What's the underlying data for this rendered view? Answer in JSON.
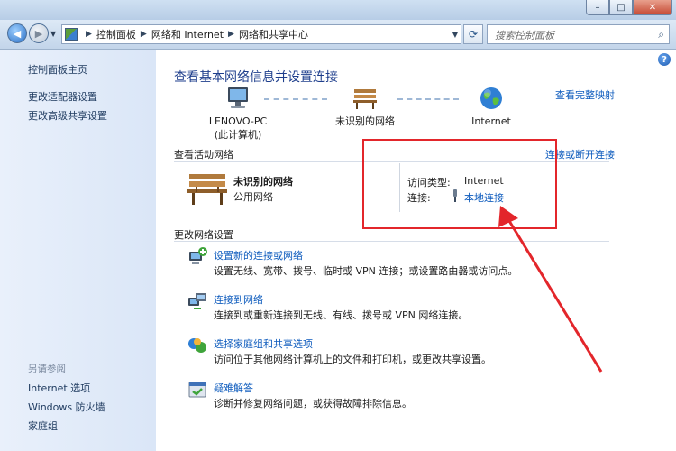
{
  "window": {
    "minimize": "–",
    "maximize": "□",
    "close": "✕"
  },
  "toolbar": {
    "back_glyph": "◀",
    "forward_glyph": "▶",
    "breadcrumb": [
      "控制面板",
      "网络和 Internet",
      "网络和共享中心"
    ],
    "search_placeholder": "搜索控制面板"
  },
  "sidebar": {
    "items": [
      "控制面板主页",
      "更改适配器设置",
      "更改高级共享设置"
    ],
    "see_also_title": "另请参阅",
    "see_also": [
      "Internet 选项",
      "Windows 防火墙",
      "家庭组"
    ]
  },
  "main": {
    "title": "查看基本网络信息并设置连接",
    "full_map_link": "查看完整映射",
    "map": {
      "computer_name": "LENOVO-PC",
      "computer_sub": "(此计算机)",
      "network": "未识别的网络",
      "internet": "Internet"
    },
    "active_header": "查看活动网络",
    "disconnect_link": "连接或断开连接",
    "active": {
      "name": "未识别的网络",
      "type": "公用网络",
      "access_label": "访问类型:",
      "access_value": "Internet",
      "conn_label": "连接:",
      "conn_value": "本地连接"
    },
    "change_header": "更改网络设置",
    "tasks": [
      {
        "title": "设置新的连接或网络",
        "desc": "设置无线、宽带、拨号、临时或 VPN 连接；或设置路由器或访问点。"
      },
      {
        "title": "连接到网络",
        "desc": "连接到或重新连接到无线、有线、拨号或 VPN 网络连接。"
      },
      {
        "title": "选择家庭组和共享选项",
        "desc": "访问位于其他网络计算机上的文件和打印机，或更改共享设置。"
      },
      {
        "title": "疑难解答",
        "desc": "诊断并修复网络问题，或获得故障排除信息。"
      }
    ]
  },
  "annotation": {
    "highlight_color": "#e3262b"
  }
}
